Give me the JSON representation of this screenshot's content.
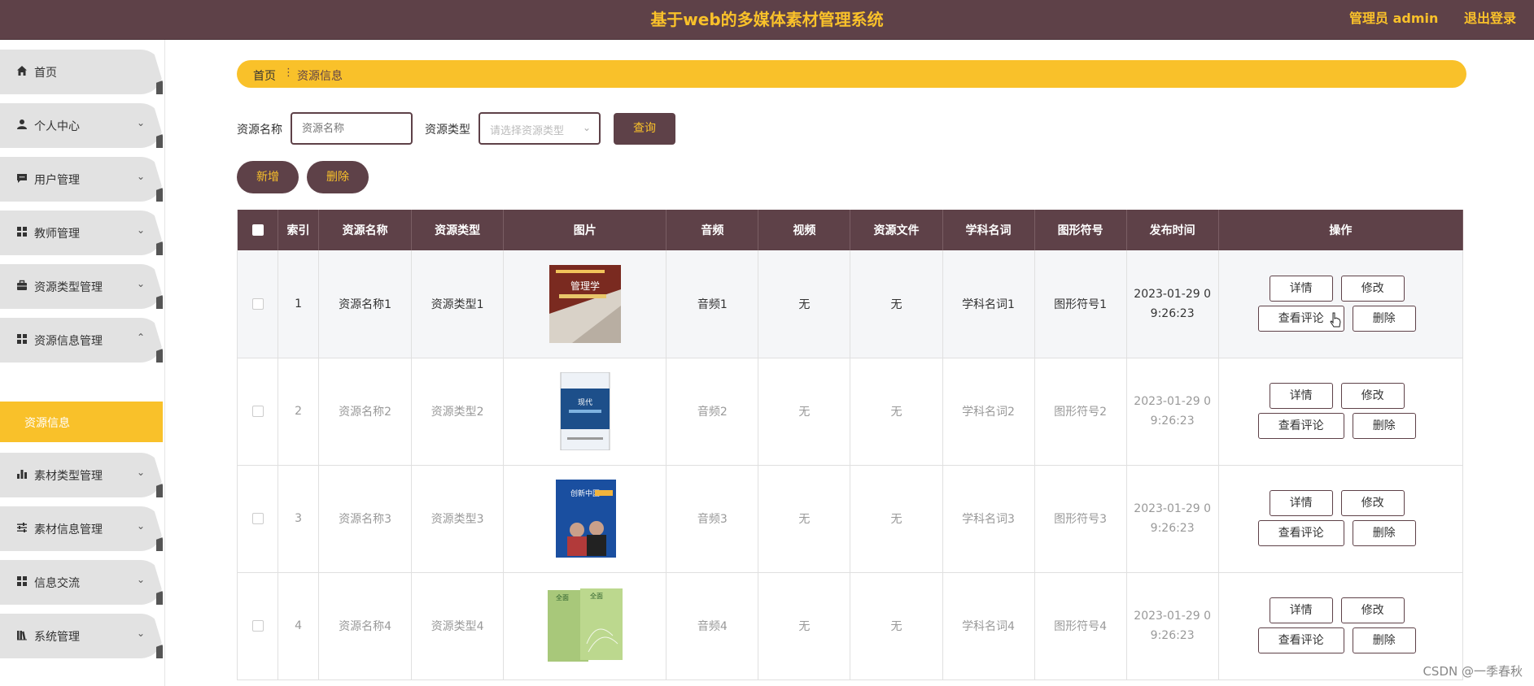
{
  "header": {
    "title": "基于web的多媒体素材管理系统",
    "user": "管理员 admin",
    "logout": "退出登录"
  },
  "sidebar": {
    "items": [
      {
        "label": "首页",
        "icon": "home-icon",
        "chevron": ""
      },
      {
        "label": "个人中心",
        "icon": "user-icon",
        "chevron": "⌄"
      },
      {
        "label": "用户管理",
        "icon": "chat-icon",
        "chevron": "⌄"
      },
      {
        "label": "教师管理",
        "icon": "grid-icon",
        "chevron": "⌄"
      },
      {
        "label": "资源类型管理",
        "icon": "briefcase-icon",
        "chevron": "⌄"
      },
      {
        "label": "资源信息管理",
        "icon": "grid-icon",
        "chevron": "⌃"
      },
      {
        "label": "素材类型管理",
        "icon": "bar-chart-icon",
        "chevron": "⌄"
      },
      {
        "label": "素材信息管理",
        "icon": "sliders-icon",
        "chevron": "⌄"
      },
      {
        "label": "信息交流",
        "icon": "grid-icon",
        "chevron": "⌄"
      },
      {
        "label": "系统管理",
        "icon": "books-icon",
        "chevron": "⌄"
      }
    ],
    "sub_item": "资源信息"
  },
  "breadcrumb": {
    "home": "首页",
    "separator": "⋮",
    "current": "资源信息"
  },
  "search": {
    "name_label": "资源名称",
    "name_placeholder": "资源名称",
    "type_label": "资源类型",
    "type_placeholder": "请选择资源类型",
    "query": "查询"
  },
  "actions": {
    "add": "新增",
    "delete": "删除"
  },
  "table": {
    "headers": [
      "索引",
      "资源名称",
      "资源类型",
      "图片",
      "音频",
      "视频",
      "资源文件",
      "学科名词",
      "图形符号",
      "发布时间",
      "操作"
    ],
    "rows": [
      {
        "index": "1",
        "name": "资源名称1",
        "type": "资源类型1",
        "audio": "音频1",
        "video": "无",
        "file": "无",
        "term": "学科名词1",
        "symbol": "图形符号1",
        "time1": "2023-01-29 0",
        "time2": "9:26:23"
      },
      {
        "index": "2",
        "name": "资源名称2",
        "type": "资源类型2",
        "audio": "音频2",
        "video": "无",
        "file": "无",
        "term": "学科名词2",
        "symbol": "图形符号2",
        "time1": "2023-01-29 0",
        "time2": "9:26:23"
      },
      {
        "index": "3",
        "name": "资源名称3",
        "type": "资源类型3",
        "audio": "音频3",
        "video": "无",
        "file": "无",
        "term": "学科名词3",
        "symbol": "图形符号3",
        "time1": "2023-01-29 0",
        "time2": "9:26:23"
      },
      {
        "index": "4",
        "name": "资源名称4",
        "type": "资源类型4",
        "audio": "音频4",
        "video": "无",
        "file": "无",
        "term": "学科名词4",
        "symbol": "图形符号4",
        "time1": "2023-01-29 0",
        "time2": "9:26:23"
      }
    ],
    "ops": {
      "detail": "详情",
      "edit": "修改",
      "comments": "查看评论",
      "delete": "删除"
    },
    "covers": [
      {
        "title": "管理学",
        "colors": [
          "#7a2a20",
          "#e8e0d8"
        ]
      },
      {
        "title": "现代",
        "colors": [
          "#1d4f8a",
          "#e8eef5"
        ]
      },
      {
        "title": "创新中国",
        "colors": [
          "#1a4fa0",
          "#2b6ec8"
        ]
      },
      {
        "title": "全面",
        "colors": [
          "#a8c87a",
          "#c4dc9a"
        ]
      }
    ]
  },
  "watermark": "CSDN @一季春秋",
  "colors": {
    "primary": "#5e4148",
    "accent": "#f9c12a"
  }
}
